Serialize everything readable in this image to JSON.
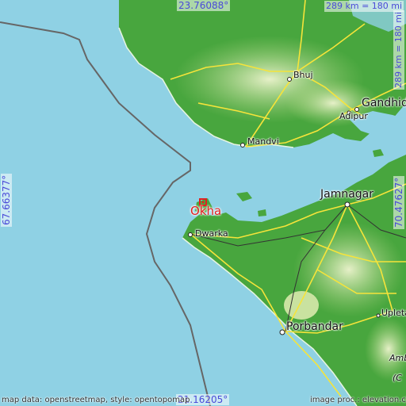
{
  "map": {
    "coords": {
      "top": "23.76088°",
      "bottom": "21.16205°",
      "left": "67.66377°",
      "right": "70.47627°"
    },
    "scale": {
      "horizontal": "289 km = 180 mi",
      "vertical": "289 km = 180 mi"
    },
    "main_city": "Okha",
    "cities": [
      "Bhuj",
      "Gandhidh",
      "Adipur",
      "Mandvi",
      "Jamnagar",
      "Dwarka",
      "Porbandar",
      "Upleta",
      "Amb",
      "(C"
    ],
    "attribution_left": "map data: openstreetmap, style: opentopomap",
    "attribution_right": "image proc.: elevation.city",
    "colors": {
      "sea": "#8fd1e4",
      "lowland": "#4caf3c",
      "highland": "#c8e3a4",
      "road": "#f6e43a",
      "border": "#666666",
      "main_marker": "#e02020",
      "coord_text": "#4a4ad8"
    }
  }
}
